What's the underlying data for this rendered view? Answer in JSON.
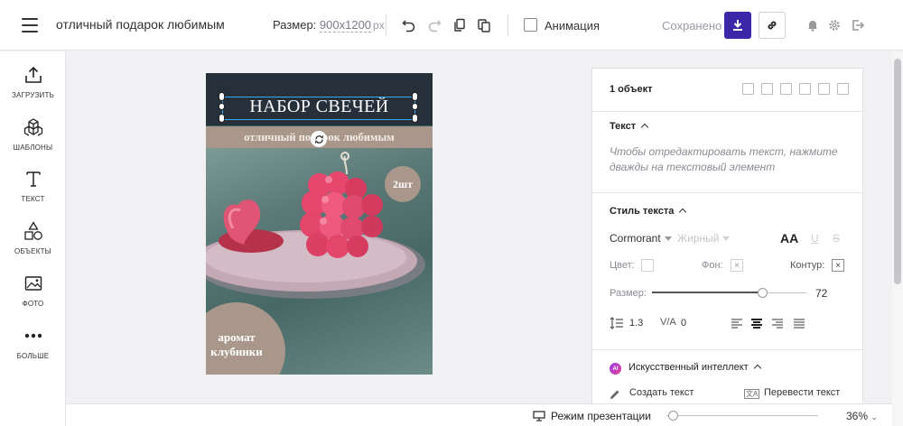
{
  "header": {
    "doc_title": "отличный подарок любимым",
    "size_label": "Размер:",
    "size_value": "900x1200",
    "size_unit": "px",
    "animation_label": "Анимация",
    "saved_status": "Сохранено"
  },
  "sidebar": {
    "items": [
      {
        "label": "ЗАГРУЗИТЬ",
        "icon": "upload-icon"
      },
      {
        "label": "ШАБЛОНЫ",
        "icon": "templates-icon"
      },
      {
        "label": "ТЕКСТ",
        "icon": "text-icon"
      },
      {
        "label": "ОБЪЕКТЫ",
        "icon": "shapes-icon"
      },
      {
        "label": "ФОТО",
        "icon": "photo-icon"
      },
      {
        "label": "БОЛЬШЕ",
        "icon": "more-icon"
      }
    ]
  },
  "canvas": {
    "headline": "НАБОР СВЕЧЕЙ",
    "ribbon": "отличный подарок любимым",
    "badge": "2шт",
    "corner_line1": "аромат",
    "corner_line2": "клубники"
  },
  "panel": {
    "object_count": "1 объект",
    "text_section_title": "Текст",
    "text_hint": "Чтобы отредактировать текст, нажмите дважды на текстовый элемент",
    "style_section_title": "Стиль текста",
    "font_family": "Cormorant",
    "font_weight": "Жирный",
    "format_aa": "AA",
    "format_u": "U",
    "format_s": "S",
    "color_label": "Цвет:",
    "bg_label": "Фон:",
    "outline_label": "Контур:",
    "size_label": "Размер:",
    "size_value": "72",
    "size_fraction": 0.72,
    "line_height": "1.3",
    "letter_spacing": "0",
    "ai_section_title": "Искусственный интеллект",
    "ai_create": "Создать текст",
    "ai_translate": "Перевести текст"
  },
  "footer": {
    "presentation_label": "Режим презентации",
    "zoom_value": "36%"
  }
}
